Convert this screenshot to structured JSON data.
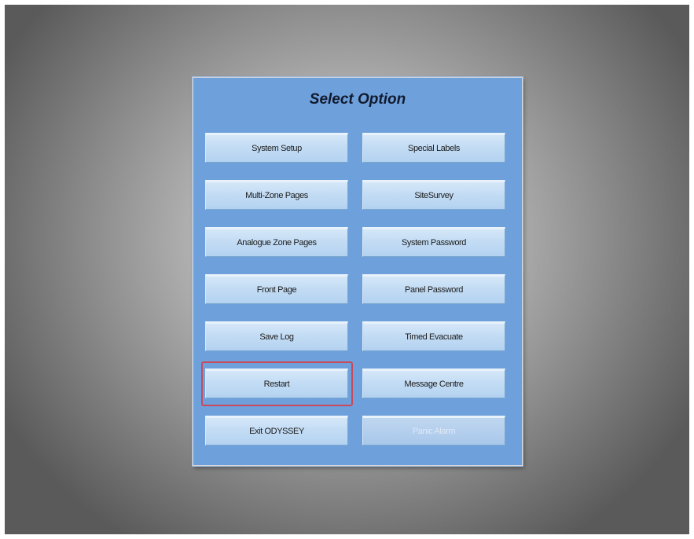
{
  "dialog": {
    "title": "Select Option"
  },
  "buttons": {
    "system_setup": "System Setup",
    "special_labels": "Special Labels",
    "multi_zone_pages": "Multi-Zone Pages",
    "site_survey": "SiteSurvey",
    "analogue_zone_pages": "Analogue Zone Pages",
    "system_password": "System Password",
    "front_page": "Front Page",
    "panel_password": "Panel Password",
    "save_log": "Save Log",
    "timed_evacuate": "Timed Evacuate",
    "restart": "Restart",
    "message_centre": "Message Centre",
    "exit_odyssey": "Exit ODYSSEY",
    "panic_alarm": "Panic Alarm"
  },
  "state": {
    "highlighted_button": "restart",
    "disabled_buttons": [
      "panic_alarm"
    ],
    "highlight_color": "#c64a5c",
    "panel_color": "#6ea0dc"
  }
}
